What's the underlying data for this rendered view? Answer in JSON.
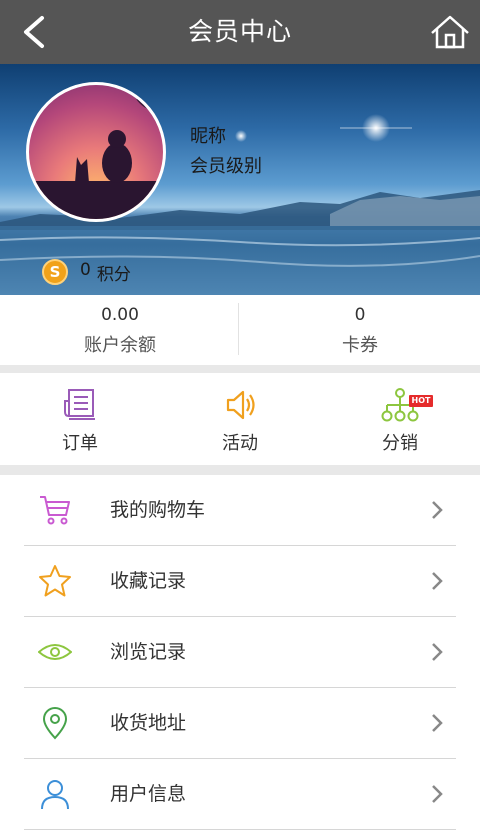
{
  "header": {
    "title": "会员中心"
  },
  "profile": {
    "nickname": "昵称",
    "level": "会员级别",
    "points_value": "0",
    "points_label": "积分"
  },
  "stats": [
    {
      "value": "0.00",
      "label": "账户余额"
    },
    {
      "value": "0",
      "label": "卡券"
    }
  ],
  "quick_actions": [
    {
      "label": "订单",
      "icon": "order-icon",
      "color": "#9a5bb8"
    },
    {
      "label": "活动",
      "icon": "activity-speaker-icon",
      "color": "#f0a01e"
    },
    {
      "label": "分销",
      "icon": "distribution-tree-icon",
      "color": "#8dc63f",
      "badge": "HOT"
    }
  ],
  "menu": [
    {
      "label": "我的购物车",
      "icon": "cart-icon",
      "color": "#c95ad1"
    },
    {
      "label": "收藏记录",
      "icon": "star-icon",
      "color": "#f0a01e"
    },
    {
      "label": "浏览记录",
      "icon": "eye-icon",
      "color": "#8dc63f"
    },
    {
      "label": "收货地址",
      "icon": "location-pin-icon",
      "color": "#46a24a"
    },
    {
      "label": "用户信息",
      "icon": "user-icon",
      "color": "#3c8fd8"
    }
  ],
  "colors": {
    "header_bg": "#555555",
    "hot_badge": "#e52b2b",
    "coin": "#f1a21a"
  }
}
